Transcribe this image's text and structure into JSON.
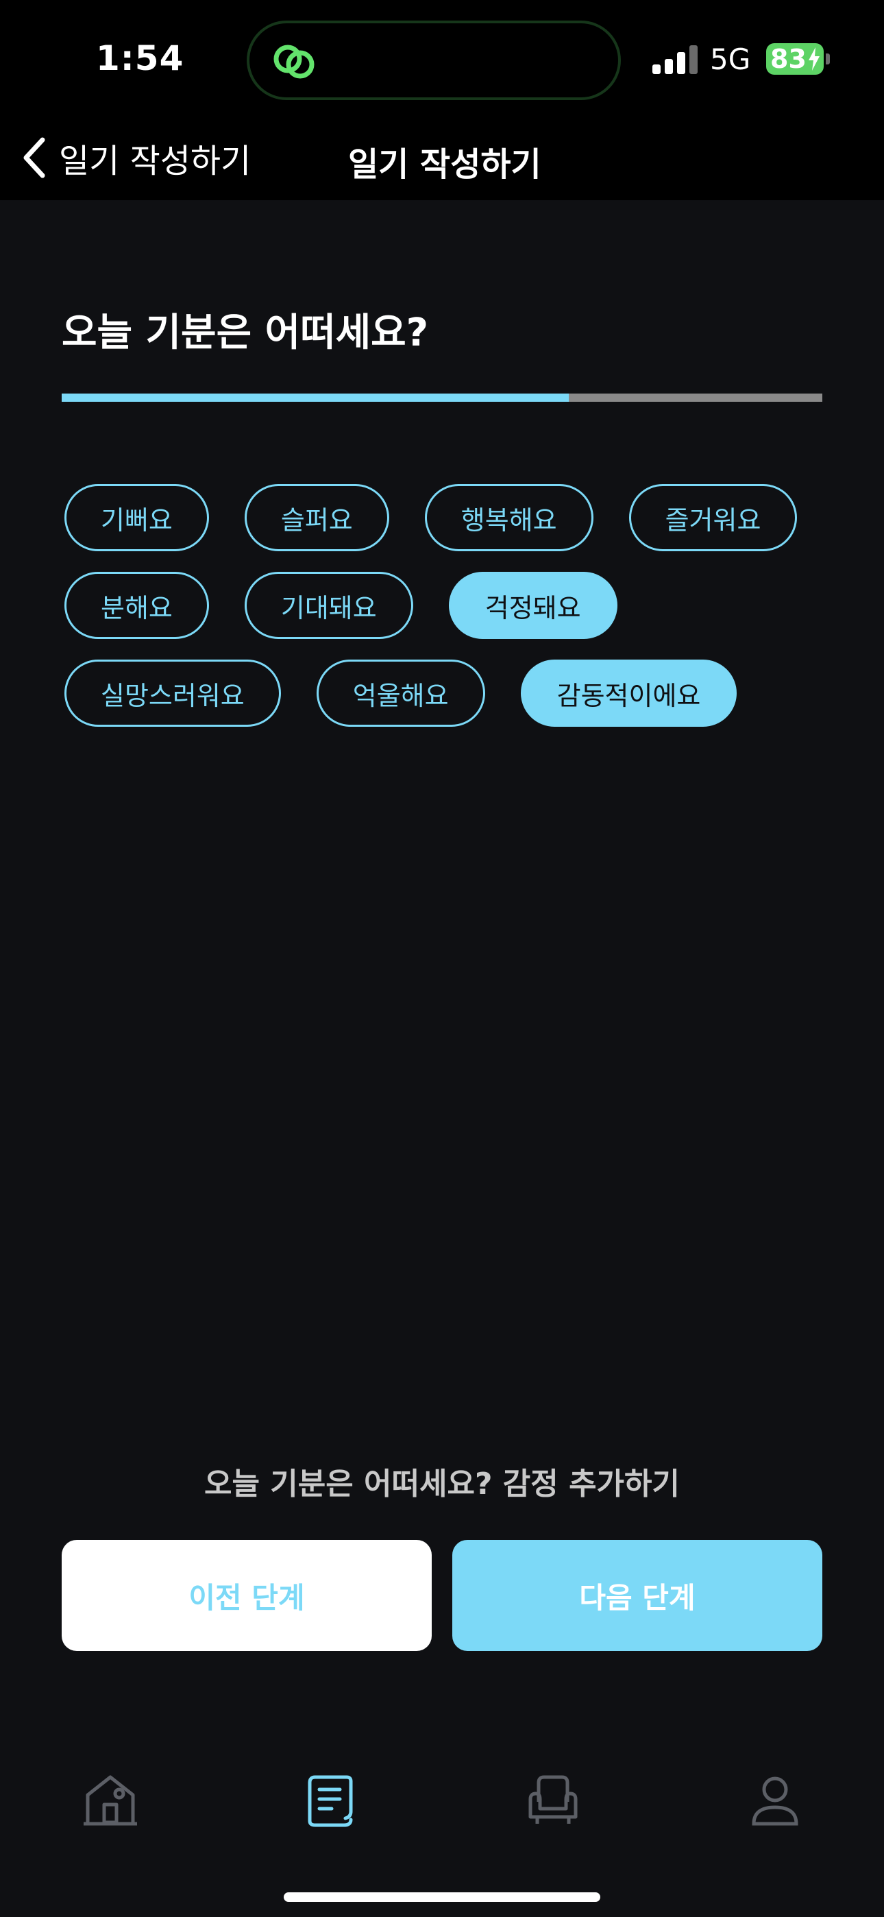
{
  "status_bar": {
    "time": "1:54",
    "network": "5G",
    "battery": "83"
  },
  "nav": {
    "back_label": "일기 작성하기",
    "title": "일기 작성하기"
  },
  "main": {
    "question": "오늘 기분은 어떠세요?",
    "progress_fraction": 0.667,
    "emotions": [
      [
        {
          "label": "기뻐요",
          "selected": false
        },
        {
          "label": "슬퍼요",
          "selected": false
        },
        {
          "label": "행복해요",
          "selected": false
        },
        {
          "label": "즐거워요",
          "selected": false
        }
      ],
      [
        {
          "label": "분해요",
          "selected": false
        },
        {
          "label": "기대돼요",
          "selected": false
        },
        {
          "label": "걱정돼요",
          "selected": true
        }
      ],
      [
        {
          "label": "실망스러워요",
          "selected": false
        },
        {
          "label": "억울해요",
          "selected": false
        },
        {
          "label": "감동적이에요",
          "selected": true
        }
      ]
    ],
    "hint": "오늘 기분은 어떠세요?  감정 추가하기",
    "prev_label": "이전 단계",
    "next_label": "다음 단계"
  },
  "tabs": [
    {
      "name": "home",
      "icon": "home-icon",
      "active": false
    },
    {
      "name": "diary",
      "icon": "diary-icon",
      "active": true
    },
    {
      "name": "lounge",
      "icon": "chair-icon",
      "active": false
    },
    {
      "name": "profile",
      "icon": "profile-icon",
      "active": false
    }
  ],
  "colors": {
    "accent": "#7cd9f7",
    "background": "#0f1013",
    "battery": "#5dd365",
    "inactive_icon": "#5c5f66"
  }
}
